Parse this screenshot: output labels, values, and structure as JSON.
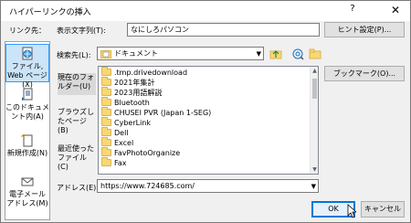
{
  "window": {
    "title": "ハイパーリンクの挿入",
    "help_glyph": "?",
    "close_glyph": "✕"
  },
  "labels": {
    "link_to": "リンク先：",
    "display_text": "表示文字列(T):",
    "search_in": "検索先(L):",
    "address": "アドレス(E):"
  },
  "display_text_value": "なにしろパソコン",
  "screentip_button": "ヒント設定(P)...",
  "look_in": {
    "value": "ドキュメント"
  },
  "bookmark_button": "ブックマーク(O)...",
  "linkbar": [
    {
      "label": "ファイル, Web ページ(X)",
      "icon": "web-page-icon",
      "selected": true
    },
    {
      "label": "このドキュメント内(A)",
      "icon": "document-icon",
      "selected": false
    },
    {
      "label": "新規作成(N)",
      "icon": "new-document-icon",
      "selected": false
    },
    {
      "label": "電子メール アドレス(M)",
      "icon": "email-icon",
      "selected": false
    }
  ],
  "places": [
    {
      "label": "現在のフォルダー(U)",
      "selected": true
    },
    {
      "label": "ブラウズしたページ(B)",
      "selected": false
    },
    {
      "label": "最近使ったファイル(C)",
      "selected": false
    }
  ],
  "files": [
    ".tmp.drivedownload",
    "2021年集計",
    "2023用語解説",
    "Bluetooth",
    "CHUSEI PVR (Japan 1-SEG)",
    "CyberLink",
    "Dell",
    "Excel",
    "FavPhotoOrganize",
    "Fax"
  ],
  "address_value": "https://www.724685.com/",
  "buttons": {
    "ok": "OK",
    "cancel": "キャンセル"
  },
  "colors": {
    "selection": "#cce4f7",
    "accent": "#0078d7",
    "folder": "#f8d775"
  }
}
